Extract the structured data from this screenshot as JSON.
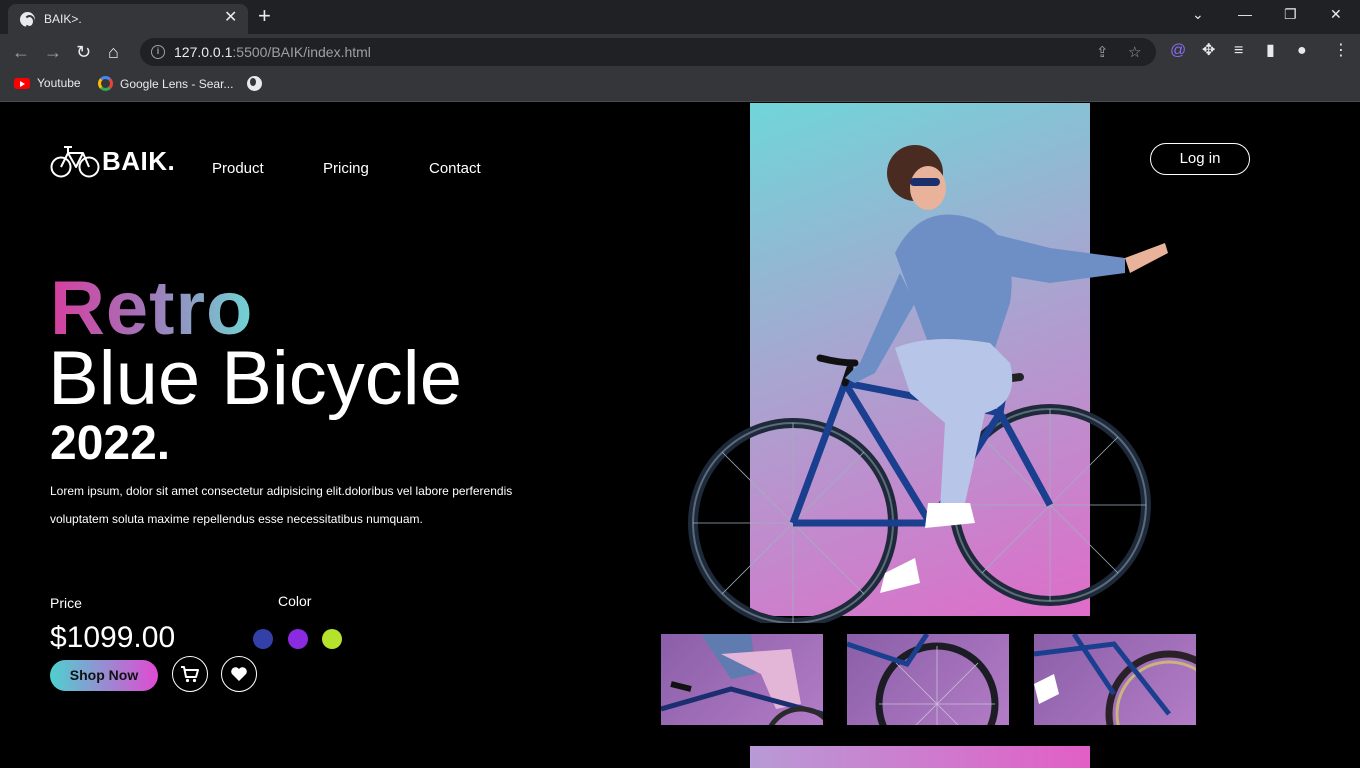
{
  "browser": {
    "tab_title": "BAIK>.",
    "url_host": "127.0.0.1",
    "url_rest": ":5500/BAIK/index.html",
    "bookmarks": [
      {
        "label": "Youtube",
        "icon": "youtube-icon"
      },
      {
        "label": "Google Lens - Sear...",
        "icon": "google-lens-icon"
      },
      {
        "label": "",
        "icon": "globe-icon"
      }
    ]
  },
  "site": {
    "logo_text": "BAIK.",
    "nav": [
      "Product",
      "Pricing",
      "Contact"
    ],
    "login_label": "Log in",
    "hero": {
      "line1": "Retro",
      "line2": "Blue Bicycle",
      "line3": "2022.",
      "description": "Lorem ipsum, dolor sit amet consectetur adipisicing elit.doloribus vel labore perferendis voluptatem soluta maxime repellendus esse necessitatibus numquam."
    },
    "price_label": "Price",
    "price": "$1099.00",
    "color_label": "Color",
    "colors": [
      "#3340a8",
      "#8a2be2",
      "#b5e32d"
    ],
    "shop_label": "Shop Now",
    "icons": [
      "cart-icon",
      "heart-icon"
    ]
  }
}
